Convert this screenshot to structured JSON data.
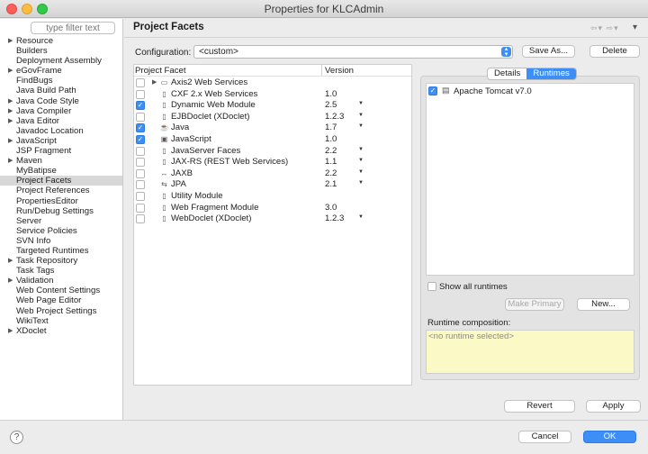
{
  "window": {
    "title": "Properties for KLCAdmin"
  },
  "sidebar": {
    "filter_placeholder": "type filter text",
    "items": [
      {
        "label": "Resource",
        "expandable": true
      },
      {
        "label": "Builders",
        "expandable": false
      },
      {
        "label": "Deployment Assembly",
        "expandable": false
      },
      {
        "label": "eGovFrame",
        "expandable": true
      },
      {
        "label": "FindBugs",
        "expandable": false
      },
      {
        "label": "Java Build Path",
        "expandable": false
      },
      {
        "label": "Java Code Style",
        "expandable": true
      },
      {
        "label": "Java Compiler",
        "expandable": true
      },
      {
        "label": "Java Editor",
        "expandable": true
      },
      {
        "label": "Javadoc Location",
        "expandable": false
      },
      {
        "label": "JavaScript",
        "expandable": true
      },
      {
        "label": "JSP Fragment",
        "expandable": false
      },
      {
        "label": "Maven",
        "expandable": true
      },
      {
        "label": "MyBatipse",
        "expandable": false
      },
      {
        "label": "Project Facets",
        "expandable": false,
        "selected": true
      },
      {
        "label": "Project References",
        "expandable": false
      },
      {
        "label": "PropertiesEditor",
        "expandable": false
      },
      {
        "label": "Run/Debug Settings",
        "expandable": false
      },
      {
        "label": "Server",
        "expandable": false
      },
      {
        "label": "Service Policies",
        "expandable": false
      },
      {
        "label": "SVN Info",
        "expandable": false
      },
      {
        "label": "Targeted Runtimes",
        "expandable": false
      },
      {
        "label": "Task Repository",
        "expandable": true
      },
      {
        "label": "Task Tags",
        "expandable": false
      },
      {
        "label": "Validation",
        "expandable": true
      },
      {
        "label": "Web Content Settings",
        "expandable": false
      },
      {
        "label": "Web Page Editor",
        "expandable": false
      },
      {
        "label": "Web Project Settings",
        "expandable": false
      },
      {
        "label": "WikiText",
        "expandable": false
      },
      {
        "label": "XDoclet",
        "expandable": true
      }
    ]
  },
  "page": {
    "heading": "Project Facets"
  },
  "configuration": {
    "label": "Configuration:",
    "value": "<custom>",
    "save_as": "Save As...",
    "delete": "Delete"
  },
  "facets": {
    "col_facet": "Project Facet",
    "col_version": "Version",
    "rows": [
      {
        "name": "Axis2 Web Services",
        "version": "",
        "checked": false,
        "expandable": true,
        "dropdown": false,
        "icon": "folder-icon"
      },
      {
        "name": "CXF 2.x Web Services",
        "version": "1.0",
        "checked": false,
        "expandable": false,
        "dropdown": false,
        "icon": "page-icon"
      },
      {
        "name": "Dynamic Web Module",
        "version": "2.5",
        "checked": true,
        "expandable": false,
        "dropdown": true,
        "icon": "page-icon"
      },
      {
        "name": "EJBDoclet (XDoclet)",
        "version": "1.2.3",
        "checked": false,
        "expandable": false,
        "dropdown": true,
        "icon": "page-icon"
      },
      {
        "name": "Java",
        "version": "1.7",
        "checked": true,
        "expandable": false,
        "dropdown": true,
        "icon": "java-icon"
      },
      {
        "name": "JavaScript",
        "version": "1.0",
        "checked": true,
        "expandable": false,
        "dropdown": false,
        "icon": "javascript-icon"
      },
      {
        "name": "JavaServer Faces",
        "version": "2.2",
        "checked": false,
        "expandable": false,
        "dropdown": true,
        "icon": "page-icon"
      },
      {
        "name": "JAX-RS (REST Web Services)",
        "version": "1.1",
        "checked": false,
        "expandable": false,
        "dropdown": true,
        "icon": "page-icon"
      },
      {
        "name": "JAXB",
        "version": "2.2",
        "checked": false,
        "expandable": false,
        "dropdown": true,
        "icon": "jaxb-icon"
      },
      {
        "name": "JPA",
        "version": "2.1",
        "checked": false,
        "expandable": false,
        "dropdown": true,
        "icon": "jpa-icon"
      },
      {
        "name": "Utility Module",
        "version": "",
        "checked": false,
        "expandable": false,
        "dropdown": false,
        "icon": "page-icon"
      },
      {
        "name": "Web Fragment Module",
        "version": "3.0",
        "checked": false,
        "expandable": false,
        "dropdown": false,
        "icon": "page-icon"
      },
      {
        "name": "WebDoclet (XDoclet)",
        "version": "1.2.3",
        "checked": false,
        "expandable": false,
        "dropdown": true,
        "icon": "page-icon"
      }
    ]
  },
  "tabs": [
    {
      "label": "Details",
      "active": false
    },
    {
      "label": "Runtimes",
      "active": true
    }
  ],
  "runtimes": {
    "items": [
      {
        "name": "Apache Tomcat v7.0",
        "checked": true
      }
    ],
    "show_all_label": "Show all runtimes",
    "make_primary": "Make Primary",
    "new": "New...",
    "composition_label": "Runtime composition:",
    "composition_value": "<no runtime selected>"
  },
  "footer": {
    "revert": "Revert",
    "apply": "Apply",
    "cancel": "Cancel",
    "ok": "OK",
    "help_glyph": "?"
  },
  "colors": {
    "accent": "#3d8ef7",
    "composition_bg": "#fbf9c6",
    "selection": "#d8d8d8"
  }
}
